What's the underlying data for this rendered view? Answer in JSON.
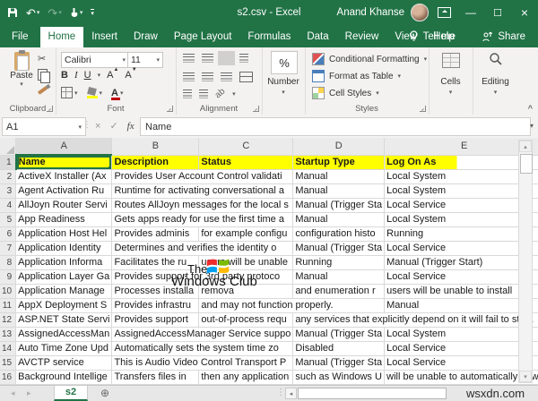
{
  "titlebar": {
    "title": "s2.csv - Excel",
    "user": "Anand Khanse"
  },
  "icons": {
    "undo": "↶",
    "redo": "↷",
    "dropdown": "▾",
    "cut": "✂",
    "cancel": "×",
    "enter": "✓",
    "scroll_up": "▴",
    "scroll_down": "▾",
    "scroll_left": "◂",
    "scroll_right": "▸",
    "nav_left": "◂",
    "nav_right": "▸",
    "plus": "⊕",
    "dots": "⋮",
    "collapse": "^"
  },
  "tabs": {
    "file": "File",
    "items": [
      "Home",
      "Insert",
      "Draw",
      "Page Layout",
      "Formulas",
      "Data",
      "Review",
      "View",
      "Help"
    ],
    "active": "Home",
    "tellme": "Tell me",
    "share": "Share"
  },
  "ribbon": {
    "clipboard": {
      "label": "Clipboard",
      "paste": "Paste"
    },
    "font": {
      "label": "Font",
      "name": "Calibri",
      "size": "11",
      "bold": "B",
      "italic": "I",
      "underline": "U",
      "grow": "A",
      "shrink": "A",
      "color_letter": "A"
    },
    "alignment": {
      "label": "Alignment"
    },
    "number": {
      "label": "Number",
      "percent": "%"
    },
    "styles": {
      "label": "Styles",
      "items": [
        "Conditional Formatting",
        "Format as Table",
        "Cell Styles"
      ]
    },
    "cells": {
      "label": "Cells"
    },
    "editing": {
      "label": "Editing"
    }
  },
  "formula_bar": {
    "name_box": "A1",
    "fx": "fx",
    "value": "Name"
  },
  "grid": {
    "columns": [
      "A",
      "B",
      "C",
      "D",
      "E"
    ],
    "active_cell": "A1",
    "rows": [
      {
        "n": "1",
        "cells": [
          {
            "col": "A",
            "span": 1,
            "text": "Name"
          },
          {
            "col": "B",
            "span": 1,
            "text": "Description"
          },
          {
            "col": "C",
            "span": 1,
            "text": "Status"
          },
          {
            "col": "D",
            "span": 1,
            "text": "Startup Type"
          },
          {
            "col": "E",
            "span": 1,
            "text": "Log On As"
          }
        ]
      },
      {
        "n": "2",
        "cells": [
          {
            "col": "A",
            "span": 1,
            "text": "ActiveX Installer (Ax"
          },
          {
            "col": "B",
            "span": 2,
            "text": "Provides User Account Control validati"
          },
          {
            "col": "D",
            "span": 1,
            "text": "Manual"
          },
          {
            "col": "E",
            "span": 1,
            "text": "Local System"
          }
        ]
      },
      {
        "n": "3",
        "cells": [
          {
            "col": "A",
            "span": 1,
            "text": "Agent Activation Ru"
          },
          {
            "col": "B",
            "span": 2,
            "text": "Runtime for activating conversational a"
          },
          {
            "col": "D",
            "span": 1,
            "text": "Manual"
          },
          {
            "col": "E",
            "span": 1,
            "text": "Local System"
          }
        ]
      },
      {
        "n": "4",
        "cells": [
          {
            "col": "A",
            "span": 1,
            "text": "AllJoyn Router Servi"
          },
          {
            "col": "B",
            "span": 2,
            "text": "Routes AllJoyn messages for the local s"
          },
          {
            "col": "D",
            "span": 1,
            "text": "Manual (Trigger Sta"
          },
          {
            "col": "E",
            "span": 1,
            "text": "Local Service"
          }
        ]
      },
      {
        "n": "5",
        "cells": [
          {
            "col": "A",
            "span": 1,
            "text": "App Readiness"
          },
          {
            "col": "B",
            "span": 2,
            "text": "Gets apps ready for use the first time a"
          },
          {
            "col": "D",
            "span": 1,
            "text": "Manual"
          },
          {
            "col": "E",
            "span": 1,
            "text": "Local System"
          }
        ]
      },
      {
        "n": "6",
        "cells": [
          {
            "col": "A",
            "span": 1,
            "text": "Application Host Hel"
          },
          {
            "col": "B",
            "span": 1,
            "text": "Provides adminis"
          },
          {
            "col": "C",
            "span": 1,
            "text": "for example configu"
          },
          {
            "col": "D",
            "span": 1,
            "text": "configuration histo"
          },
          {
            "col": "E",
            "span": 1,
            "text": "Running"
          }
        ]
      },
      {
        "n": "7",
        "cells": [
          {
            "col": "A",
            "span": 1,
            "text": "Application Identity"
          },
          {
            "col": "B",
            "span": 2,
            "text": "Determines and verifies the identity o"
          },
          {
            "col": "D",
            "span": 1,
            "text": "Manual (Trigger Sta"
          },
          {
            "col": "E",
            "span": 1,
            "text": "Local Service"
          }
        ]
      },
      {
        "n": "8",
        "cells": [
          {
            "col": "A",
            "span": 1,
            "text": "Application Informa"
          },
          {
            "col": "B",
            "span": 1,
            "text": "Facilitates the ru"
          },
          {
            "col": "C",
            "span": 1,
            "text": "users will be unable"
          },
          {
            "col": "D",
            "span": 1,
            "text": "Running"
          },
          {
            "col": "E",
            "span": 1,
            "text": "Manual (Trigger Start)"
          }
        ]
      },
      {
        "n": "9",
        "cells": [
          {
            "col": "A",
            "span": 1,
            "text": "Application Layer Ga"
          },
          {
            "col": "B",
            "span": 2,
            "text": "Provides support for 3rd party protoco"
          },
          {
            "col": "D",
            "span": 1,
            "text": "Manual"
          },
          {
            "col": "E",
            "span": 1,
            "text": "Local Service"
          }
        ]
      },
      {
        "n": "10",
        "cells": [
          {
            "col": "A",
            "span": 1,
            "text": "Application Manage"
          },
          {
            "col": "B",
            "span": 1,
            "text": "Processes installa"
          },
          {
            "col": "C",
            "span": 1,
            "text": "remova"
          },
          {
            "col": "D",
            "span": 1,
            "text": "and enumeration r"
          },
          {
            "col": "E",
            "span": 1,
            "text": "users will be unable to install"
          }
        ]
      },
      {
        "n": "11",
        "cells": [
          {
            "col": "A",
            "span": 1,
            "text": "AppX Deployment S"
          },
          {
            "col": "B",
            "span": 1,
            "text": "Provides infrastru"
          },
          {
            "col": "C",
            "span": 2,
            "text": "and may not function properly."
          },
          {
            "col": "E",
            "span": 1,
            "text": "Manual"
          }
        ]
      },
      {
        "n": "12",
        "cells": [
          {
            "col": "A",
            "span": 1,
            "text": "ASP.NET State Servi"
          },
          {
            "col": "B",
            "span": 1,
            "text": "Provides support"
          },
          {
            "col": "C",
            "span": 1,
            "text": "out-of-process requ"
          },
          {
            "col": "D",
            "span": 2,
            "text": "any services that explicitly depend on it will fail to start."
          }
        ]
      },
      {
        "n": "13",
        "cells": [
          {
            "col": "A",
            "span": 1,
            "text": "AssignedAccessMan"
          },
          {
            "col": "B",
            "span": 2,
            "text": "AssignedAccessManager Service suppo"
          },
          {
            "col": "D",
            "span": 1,
            "text": "Manual (Trigger Sta"
          },
          {
            "col": "E",
            "span": 1,
            "text": "Local System"
          }
        ]
      },
      {
        "n": "14",
        "cells": [
          {
            "col": "A",
            "span": 1,
            "text": "Auto Time Zone Upd"
          },
          {
            "col": "B",
            "span": 2,
            "text": "Automatically sets the system time zo"
          },
          {
            "col": "D",
            "span": 1,
            "text": "Disabled"
          },
          {
            "col": "E",
            "span": 1,
            "text": "Local Service"
          }
        ]
      },
      {
        "n": "15",
        "cells": [
          {
            "col": "A",
            "span": 1,
            "text": "AVCTP service"
          },
          {
            "col": "B",
            "span": 2,
            "text": "This is Audio Video Control Transport P"
          },
          {
            "col": "D",
            "span": 1,
            "text": "Manual (Trigger Sta"
          },
          {
            "col": "E",
            "span": 1,
            "text": "Local Service"
          }
        ]
      },
      {
        "n": "16",
        "cells": [
          {
            "col": "A",
            "span": 1,
            "text": "Background Intellige"
          },
          {
            "col": "B",
            "span": 1,
            "text": "Transfers files in"
          },
          {
            "col": "C",
            "span": 1,
            "text": "then any application"
          },
          {
            "col": "D",
            "span": 1,
            "text": "such as Windows U"
          },
          {
            "col": "E",
            "span": 1,
            "text": "will be unable to automatically dowr"
          }
        ]
      }
    ]
  },
  "sheet_bar": {
    "active_tab": "s2"
  },
  "watermark": {
    "line1": "The",
    "line2": "Windows Club",
    "site": "wsxdn.com",
    "logo_colors": {
      "tl": "#ef2b2d",
      "tr": "#7cbb00",
      "bl": "#00a1f1",
      "br": "#ffbb00"
    }
  }
}
